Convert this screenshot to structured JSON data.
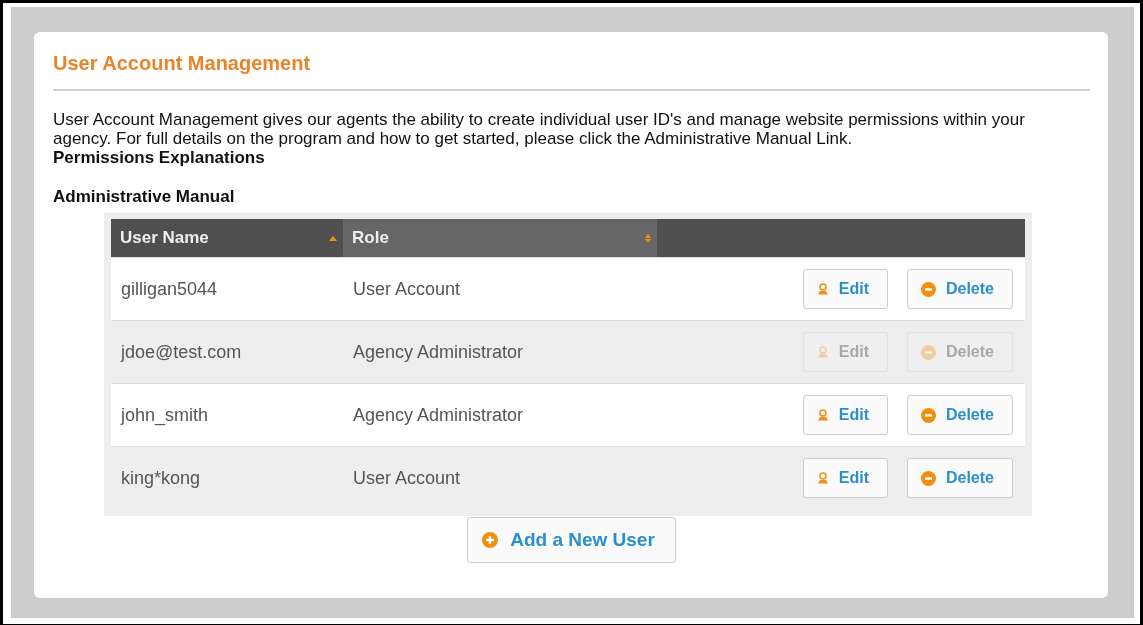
{
  "title": "User Account Management",
  "intro": "User Account Management gives our agents the ability to create individual user ID's and manage website permissions within your agency. For full details on the program and how to get started, please click the Administrative Manual Link.",
  "links": [
    "Permissions Explanations",
    "Administrative Manual"
  ],
  "table": {
    "columns": [
      {
        "label": "User Name",
        "sorted": true
      },
      {
        "label": "Role",
        "sorted": false
      }
    ],
    "rows": [
      {
        "user": "gilligan5044",
        "role": "User Account",
        "disabled": false,
        "edit": "Edit",
        "delete": "Delete"
      },
      {
        "user": "jdoe@test.com",
        "role": "Agency Administrator",
        "disabled": true,
        "edit": "Edit",
        "delete": "Delete"
      },
      {
        "user": "john_smith",
        "role": "Agency Administrator",
        "disabled": false,
        "edit": "Edit",
        "delete": "Delete"
      },
      {
        "user": "king*kong",
        "role": "User Account",
        "disabled": false,
        "edit": "Edit",
        "delete": "Delete"
      }
    ]
  },
  "add_button": "Add a New User"
}
